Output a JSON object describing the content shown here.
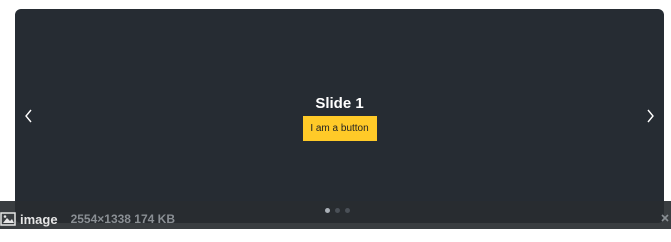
{
  "carousel": {
    "background": "#262c33",
    "slide_title": "Slide 1",
    "button_label": "I am a button",
    "button_color": "#ffca28",
    "prev_icon": "chevron-left-icon",
    "next_icon": "chevron-right-icon",
    "indicator_count": 3,
    "active_indicator": 1
  },
  "attachment": {
    "icon": "image-icon",
    "label": "image",
    "info": "2554×1338 174 KB",
    "close_icon": "close-icon"
  }
}
